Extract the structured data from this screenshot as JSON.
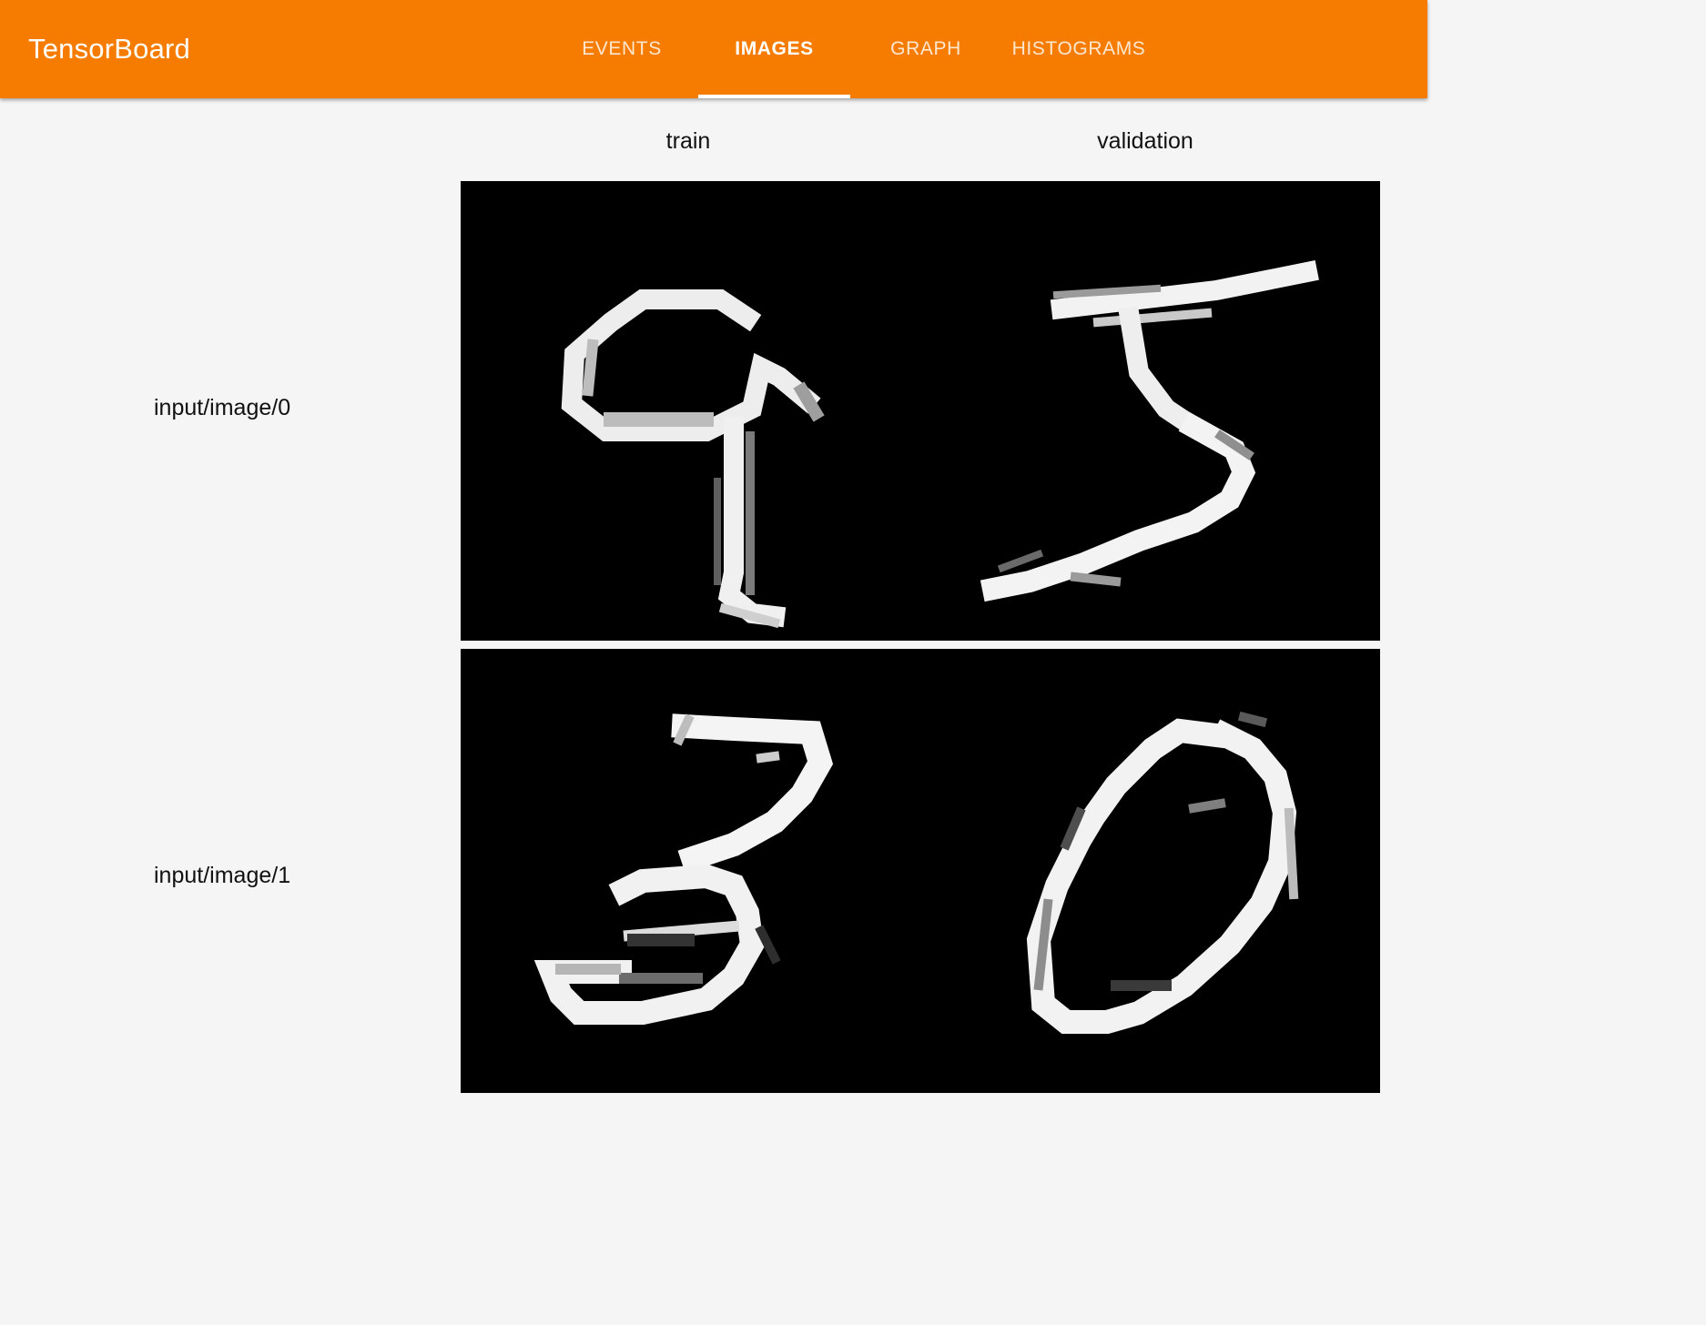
{
  "app": {
    "title": "TensorBoard",
    "accent_color": "#f57c00"
  },
  "nav": {
    "tabs": [
      {
        "label": "EVENTS",
        "active": false
      },
      {
        "label": "IMAGES",
        "active": true
      },
      {
        "label": "GRAPH",
        "active": false
      },
      {
        "label": "HISTOGRAMS",
        "active": false
      }
    ]
  },
  "images": {
    "columns": [
      "train",
      "validation"
    ],
    "rows": [
      {
        "tag": "input/image/0"
      },
      {
        "tag": "input/image/1"
      }
    ]
  }
}
